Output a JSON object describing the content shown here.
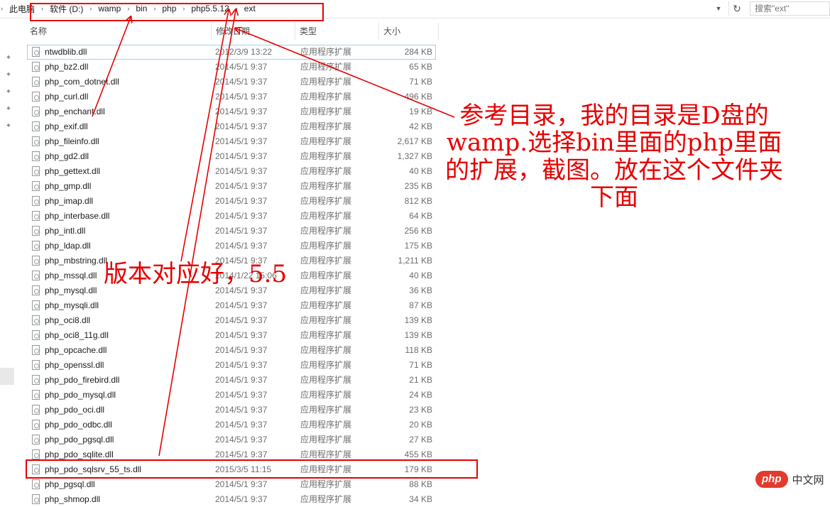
{
  "address_bar": {
    "crumbs": [
      "此电脑",
      "软件 (D:)",
      "wamp",
      "bin",
      "php",
      "php5.5.12",
      "ext"
    ],
    "search_placeholder": "搜索\"ext\""
  },
  "icons": {
    "breadcrumb_separator": "chevron-right-icon",
    "address_dropdown": "chevron-down-icon",
    "refresh": "refresh-icon",
    "quick_access_pin": "pin-icon",
    "file": "dll-file-icon"
  },
  "columns": {
    "name": "名称",
    "date": "修改日期",
    "type": "类型",
    "size": "大小"
  },
  "files": [
    {
      "name": "ntwdblib.dll",
      "date": "2012/3/9 13:22",
      "type": "应用程序扩展",
      "size": "284 KB"
    },
    {
      "name": "php_bz2.dll",
      "date": "2014/5/1 9:37",
      "type": "应用程序扩展",
      "size": "65 KB"
    },
    {
      "name": "php_com_dotnet.dll",
      "date": "2014/5/1 9:37",
      "type": "应用程序扩展",
      "size": "71 KB"
    },
    {
      "name": "php_curl.dll",
      "date": "2014/5/1 9:37",
      "type": "应用程序扩展",
      "size": "496 KB"
    },
    {
      "name": "php_enchant.dll",
      "date": "2014/5/1 9:37",
      "type": "应用程序扩展",
      "size": "19 KB"
    },
    {
      "name": "php_exif.dll",
      "date": "2014/5/1 9:37",
      "type": "应用程序扩展",
      "size": "42 KB"
    },
    {
      "name": "php_fileinfo.dll",
      "date": "2014/5/1 9:37",
      "type": "应用程序扩展",
      "size": "2,617 KB"
    },
    {
      "name": "php_gd2.dll",
      "date": "2014/5/1 9:37",
      "type": "应用程序扩展",
      "size": "1,327 KB"
    },
    {
      "name": "php_gettext.dll",
      "date": "2014/5/1 9:37",
      "type": "应用程序扩展",
      "size": "40 KB"
    },
    {
      "name": "php_gmp.dll",
      "date": "2014/5/1 9:37",
      "type": "应用程序扩展",
      "size": "235 KB"
    },
    {
      "name": "php_imap.dll",
      "date": "2014/5/1 9:37",
      "type": "应用程序扩展",
      "size": "812 KB"
    },
    {
      "name": "php_interbase.dll",
      "date": "2014/5/1 9:37",
      "type": "应用程序扩展",
      "size": "64 KB"
    },
    {
      "name": "php_intl.dll",
      "date": "2014/5/1 9:37",
      "type": "应用程序扩展",
      "size": "256 KB"
    },
    {
      "name": "php_ldap.dll",
      "date": "2014/5/1 9:37",
      "type": "应用程序扩展",
      "size": "175 KB"
    },
    {
      "name": "php_mbstring.dll",
      "date": "2014/5/1 9:37",
      "type": "应用程序扩展",
      "size": "1,211 KB"
    },
    {
      "name": "php_mssql.dll",
      "date": "2014/1/22 15:06",
      "type": "应用程序扩展",
      "size": "40 KB"
    },
    {
      "name": "php_mysql.dll",
      "date": "2014/5/1 9:37",
      "type": "应用程序扩展",
      "size": "36 KB"
    },
    {
      "name": "php_mysqli.dll",
      "date": "2014/5/1 9:37",
      "type": "应用程序扩展",
      "size": "87 KB"
    },
    {
      "name": "php_oci8.dll",
      "date": "2014/5/1 9:37",
      "type": "应用程序扩展",
      "size": "139 KB"
    },
    {
      "name": "php_oci8_11g.dll",
      "date": "2014/5/1 9:37",
      "type": "应用程序扩展",
      "size": "139 KB"
    },
    {
      "name": "php_opcache.dll",
      "date": "2014/5/1 9:37",
      "type": "应用程序扩展",
      "size": "118 KB"
    },
    {
      "name": "php_openssl.dll",
      "date": "2014/5/1 9:37",
      "type": "应用程序扩展",
      "size": "71 KB"
    },
    {
      "name": "php_pdo_firebird.dll",
      "date": "2014/5/1 9:37",
      "type": "应用程序扩展",
      "size": "21 KB"
    },
    {
      "name": "php_pdo_mysql.dll",
      "date": "2014/5/1 9:37",
      "type": "应用程序扩展",
      "size": "24 KB"
    },
    {
      "name": "php_pdo_oci.dll",
      "date": "2014/5/1 9:37",
      "type": "应用程序扩展",
      "size": "23 KB"
    },
    {
      "name": "php_pdo_odbc.dll",
      "date": "2014/5/1 9:37",
      "type": "应用程序扩展",
      "size": "20 KB"
    },
    {
      "name": "php_pdo_pgsql.dll",
      "date": "2014/5/1 9:37",
      "type": "应用程序扩展",
      "size": "27 KB"
    },
    {
      "name": "php_pdo_sqlite.dll",
      "date": "2014/5/1 9:37",
      "type": "应用程序扩展",
      "size": "455 KB"
    },
    {
      "name": "php_pdo_sqlsrv_55_ts.dll",
      "date": "2015/3/5 11:15",
      "type": "应用程序扩展",
      "size": "179 KB"
    },
    {
      "name": "php_pgsql.dll",
      "date": "2014/5/1 9:37",
      "type": "应用程序扩展",
      "size": "88 KB"
    },
    {
      "name": "php_shmop.dll",
      "date": "2014/5/1 9:37",
      "type": "应用程序扩展",
      "size": "34 KB"
    }
  ],
  "selected_row": "ntwdblib.dll",
  "annotations": {
    "note_path": "参考目录，我的目录是D盘的wamp.选择bin里面的php里面的扩展，截图。放在这个文件夹下面",
    "note_version": "版本对应好，5.5",
    "color": "#e60000"
  },
  "watermark": {
    "logo": "php",
    "text": "中文网"
  }
}
